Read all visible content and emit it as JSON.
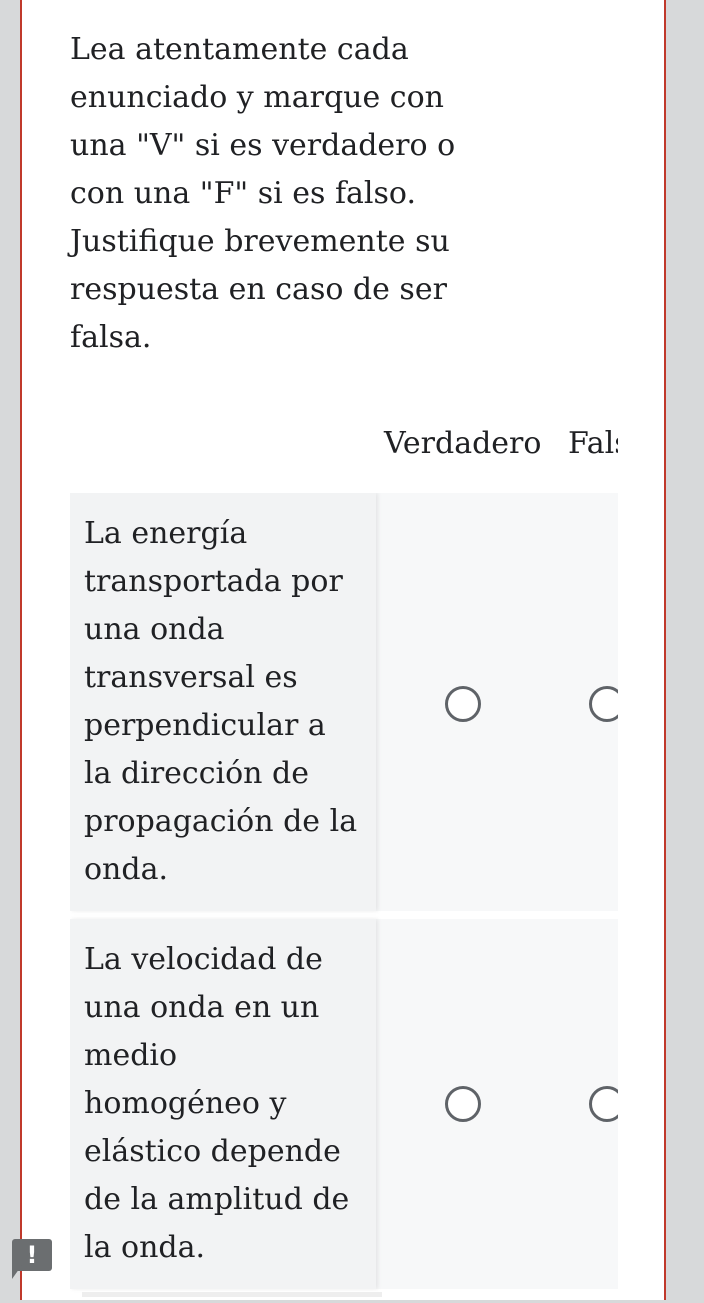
{
  "question": {
    "text": "Lea atentamente cada enunciado y marque con una \"V\" si es verdadero o con una \"F\" si es falso. Justifique brevemente su respuesta en caso de ser falsa."
  },
  "grid": {
    "columns": [
      "Verdadero",
      "Falso"
    ],
    "rows": [
      {
        "statement": "La energía transportada por una onda transversal es perpendicular a la dirección de propagación de la onda.",
        "selected": null
      },
      {
        "statement": "La velocidad de una onda en un medio homogéneo y elástico depende de la amplitud de la onda.",
        "selected": null
      }
    ]
  },
  "alert": {
    "symbol": "!"
  },
  "colors": {
    "border_accent": "#c0392b",
    "page_background": "#d7d9da",
    "radio_border": "#5f6368"
  }
}
